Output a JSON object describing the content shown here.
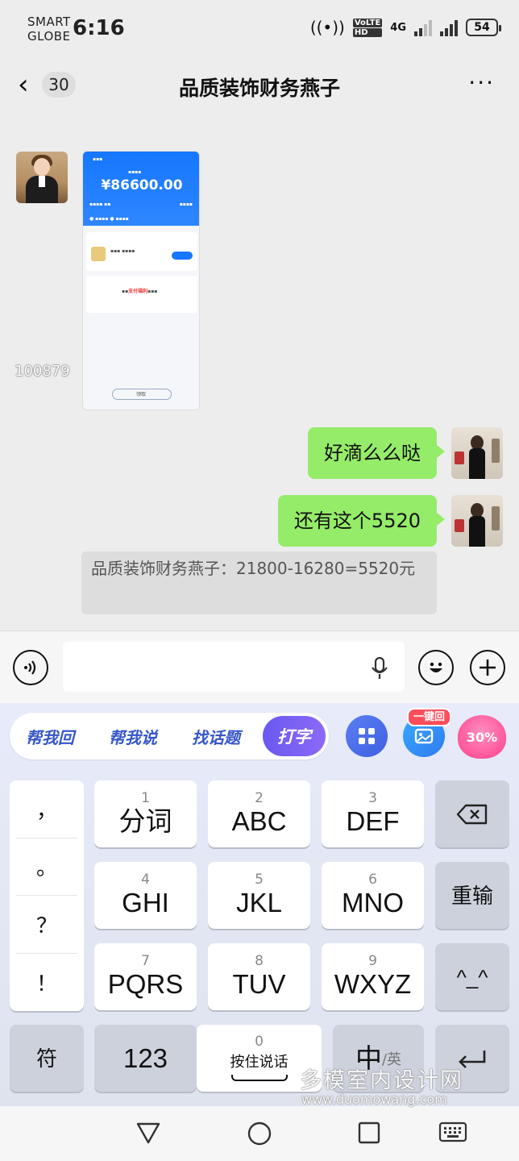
{
  "status": {
    "carrier_line1": "SMART",
    "carrier_line2": "GLOBE",
    "time": "6:16",
    "volte": "VoLTE",
    "hd": "HD",
    "network": "4G",
    "battery": "54"
  },
  "header": {
    "unread_count": "30",
    "title": "品质装饰财务燕子"
  },
  "chat": {
    "image_overlay_text": "100879",
    "screenshot": {
      "amount": "¥86600.00",
      "highlight": "支付福利",
      "btn": "领取"
    },
    "messages": [
      {
        "from": "me",
        "text": "好滴么么哒"
      },
      {
        "from": "me",
        "text": "还有这个5520"
      }
    ],
    "quote": "品质装饰财务燕子：21800-16280=5520元"
  },
  "input": {
    "placeholder": ""
  },
  "keyboard": {
    "toolbar": [
      "帮我回",
      "帮我说",
      "找话题"
    ],
    "active_tool": "打字",
    "badge": "一键回",
    "percent": "30%",
    "punctuation": [
      "，",
      "。",
      "？",
      "！"
    ],
    "keys": [
      {
        "num": "1",
        "label": "分词"
      },
      {
        "num": "2",
        "label": "ABC"
      },
      {
        "num": "3",
        "label": "DEF"
      },
      {
        "num": "4",
        "label": "GHI"
      },
      {
        "num": "5",
        "label": "JKL"
      },
      {
        "num": "6",
        "label": "MNO"
      },
      {
        "num": "7",
        "label": "PQRS"
      },
      {
        "num": "8",
        "label": "TUV"
      },
      {
        "num": "9",
        "label": "WXYZ"
      }
    ],
    "reinput": "重输",
    "face": "^_^",
    "symbols": "符",
    "numbers": "123",
    "space_num": "0",
    "space_label": "按住说话",
    "lang_main": "中",
    "lang_alt": "/英"
  },
  "watermark": {
    "cn": "多模室内设计网",
    "url": "www.duomowang.com"
  }
}
